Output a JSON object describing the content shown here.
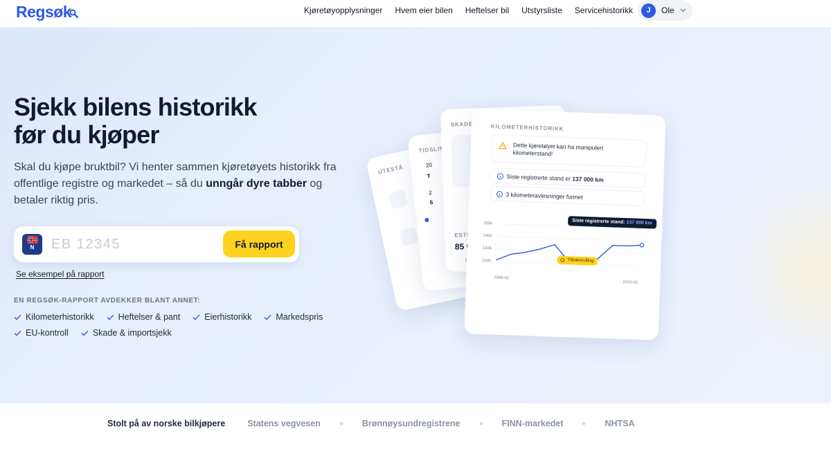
{
  "brand": {
    "name": "Regsøk",
    "accent": "#2d5be3",
    "cta_color": "#ffd21f"
  },
  "nav": {
    "items": [
      "Kjøretøyopplysninger",
      "Hvem eier bilen",
      "Heftelser bil",
      "Utstyrsliste",
      "Servicehistorikk"
    ],
    "user": {
      "initial": "J",
      "name": "Ole"
    }
  },
  "hero": {
    "headline_line1": "Sjekk bilens historikk",
    "headline_line2": "før du kjøper",
    "subtitle_pre": "Skal du kjøpe bruktbil? Vi henter sammen kjøretøyets historikk fra offentlige registre og markedet – så du ",
    "subtitle_bold": "unngår dyre tabber",
    "subtitle_post": " og betaler riktig pris.",
    "search": {
      "plate_country": "N",
      "placeholder": "EB 12345",
      "button": "Få rapport"
    },
    "example_link": "Se eksempel på rapport",
    "features_label": "EN REGSØK-RAPPORT AVDEKKER BLANT ANNET:",
    "features": [
      "Kilometerhistorikk",
      "Heftelser & pant",
      "Eierhistorikk",
      "Markedspris",
      "EU-kontroll",
      "Skade & importsjekk"
    ]
  },
  "illustration": {
    "card1_label": "UTESTÅ",
    "card2_label": "TIDSLIN",
    "card2_rows": [
      "20",
      "T",
      "2",
      "5"
    ],
    "card3_label": "SKADEH",
    "card3_estimate_label": "ESTIM",
    "card3_estimate_value": "85 0",
    "card3_footer": "SI",
    "main": {
      "title": "KILOMETERHISTORIKK",
      "warning": "Dette kjøretøyet kan ha manipulert kilometerstand!",
      "last_reading_pre": "Siste registrerte stand er ",
      "last_reading_value": "137 000 km",
      "readings": "3 kilometeravlesninger funnet",
      "tooltip_pre": "Siste registrerte stand: ",
      "tooltip_value": "137 000 km",
      "rollback_label": "Tilbakerulling"
    }
  },
  "chart_data": {
    "type": "line",
    "y_ticks": [
      "150k",
      "140k",
      "130k",
      "120k"
    ],
    "x_ticks": [
      "2006-01",
      "2010-01"
    ],
    "ylim": [
      120000,
      150000
    ],
    "series": [
      {
        "values": [
          121000,
          126000,
          128000,
          131000,
          135000,
          122000,
          122000,
          125000,
          136000,
          136000,
          137000
        ]
      }
    ]
  },
  "trust": {
    "lead": "Stolt på av norske bilkjøpere",
    "items": [
      "Statens vegvesen",
      "Brønnøysundregistrene",
      "FINN-markedet",
      "NHTSA"
    ]
  }
}
